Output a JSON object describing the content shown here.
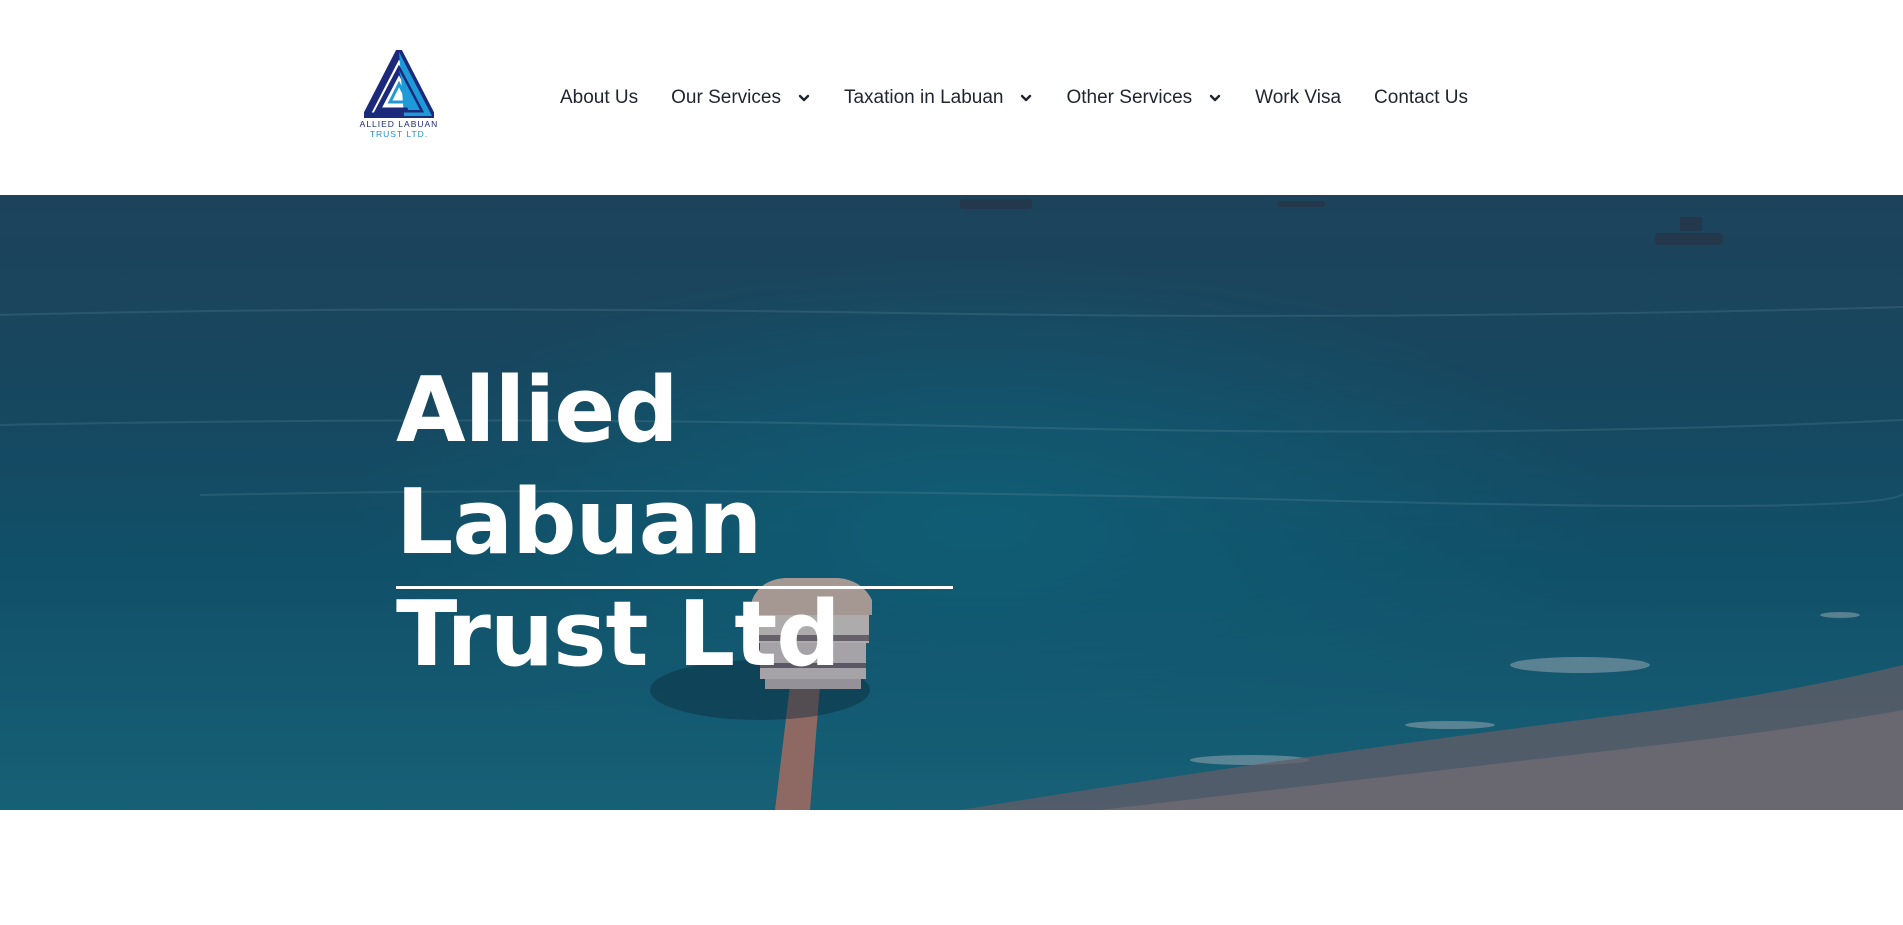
{
  "header": {
    "logo": {
      "line1": "ALLIED LABUAN",
      "line2": "TRUST LTD.",
      "icon": "triangle-logo-icon",
      "colors": {
        "dark": "#1b2a7a",
        "light": "#1f9ad8"
      }
    },
    "nav": [
      {
        "label": "About Us",
        "has_dropdown": false
      },
      {
        "label": "Our Services",
        "has_dropdown": true,
        "icon": "chevron-down-icon"
      },
      {
        "label": "Taxation in Labuan",
        "has_dropdown": true,
        "icon": "chevron-down-icon"
      },
      {
        "label": "Other Services",
        "has_dropdown": true,
        "icon": "chevron-down-icon"
      },
      {
        "label": "Work Visa",
        "has_dropdown": false
      },
      {
        "label": "Contact Us",
        "has_dropdown": false
      }
    ]
  },
  "hero": {
    "title_line1": "Allied Labuan",
    "title_line2": "Trust Ltd",
    "background_colors": {
      "sea": "#0f5a74",
      "overlay": "#162c42",
      "sand": "#6e6a72"
    }
  }
}
